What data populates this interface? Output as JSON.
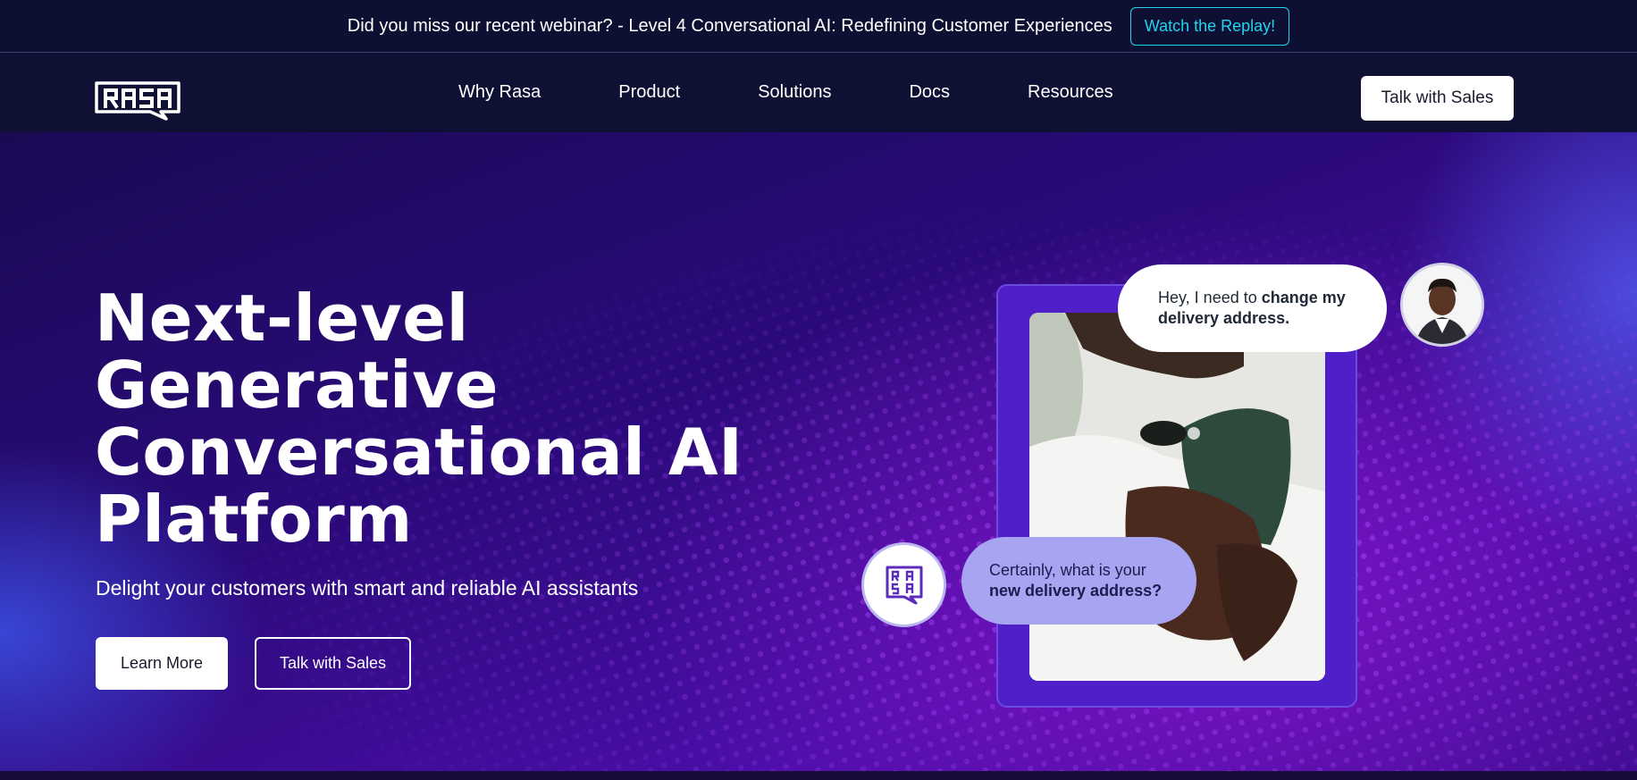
{
  "announcement": {
    "text": "Did you miss our recent webinar? - Level 4 Conversational AI: Redefining Customer Experiences",
    "button_label": "Watch the Replay!"
  },
  "nav": {
    "logo_alt": "RASA",
    "items": [
      {
        "label": "Why Rasa"
      },
      {
        "label": "Product"
      },
      {
        "label": "Solutions"
      },
      {
        "label": "Docs"
      },
      {
        "label": "Resources"
      }
    ],
    "cta_label": "Talk with Sales"
  },
  "hero": {
    "title_lines": [
      "Next-level",
      "Generative",
      "Conversational AI",
      "Platform"
    ],
    "subtitle": "Delight your customers with smart and reliable AI assistants",
    "primary_button": "Learn More",
    "secondary_button": "Talk with Sales"
  },
  "chat": {
    "user_message_plain": "Hey, I need to ",
    "user_message_bold": "change my delivery address.",
    "bot_message_plain": "Certainly, what is your ",
    "bot_message_bold": "new delivery address?"
  },
  "colors": {
    "accent_cyan": "#22d3ee",
    "nav_bg": "#0e1034",
    "frame_purple": "#4f1fc7",
    "bot_bubble": "#a7a5f2"
  }
}
